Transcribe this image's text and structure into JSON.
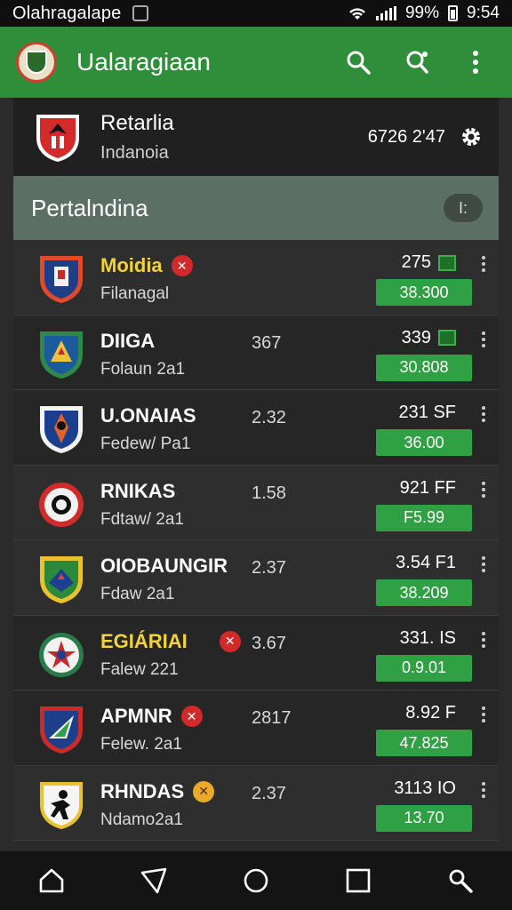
{
  "status_bar": {
    "title": "Olahragalape",
    "battery": "99%",
    "time": "9:54"
  },
  "app_bar": {
    "title": "Ualaragiaan"
  },
  "hero": {
    "team": "Retarlia",
    "subtitle": "Indanoia",
    "score": "6726 2'47"
  },
  "section": {
    "title": "Pertalndina",
    "button_label": "I:"
  },
  "matches": [
    {
      "team": "Moidia",
      "sub": "Filanagal",
      "odds": "",
      "score": "275",
      "pill": "38.300",
      "badge": "red",
      "highlight": true
    },
    {
      "team": "DIIGA",
      "sub": "Folaun 2a1",
      "odds": "367",
      "score": "339",
      "pill": "30.808",
      "badge": "",
      "highlight": false
    },
    {
      "team": "U.ONAIAS",
      "sub": "Fedew/ Pa1",
      "odds": "2.32",
      "score": "231 SF",
      "pill": "36.00",
      "badge": "",
      "highlight": false
    },
    {
      "team": "RNIKAS",
      "sub": "Fdtaw/ 2a1",
      "odds": "1.58",
      "score": "921 FF",
      "pill": "F5.99",
      "badge": "",
      "highlight": false
    },
    {
      "team": "OIOBAUNGIR",
      "sub": "Fdaw 2a1",
      "odds": "2.37",
      "score": "3.54 F1",
      "pill": "38.209",
      "badge": "",
      "highlight": false
    },
    {
      "team": "EGIÁRIAI",
      "sub": "Falew 221",
      "odds": "3.67",
      "score": "331. IS",
      "pill": "0.9.01",
      "badge": "red",
      "highlight": true
    },
    {
      "team": "APMNR",
      "sub": "Felew. 2a1",
      "odds": "2817",
      "score": "8.92 F",
      "pill": "47.825",
      "badge": "red",
      "highlight": false
    },
    {
      "team": "RHNDAS",
      "sub": "Ndamo2a1",
      "odds": "2.37",
      "score": "3113 IO",
      "pill": "13.70",
      "badge": "yellow",
      "highlight": false
    }
  ],
  "icons": {
    "app_actions": [
      "search-icon",
      "share-icon",
      "more-vert-icon"
    ],
    "nav": [
      "home-icon",
      "back-icon",
      "circle-home-icon",
      "recents-icon",
      "search-icon"
    ]
  },
  "colors": {
    "appbar": "#2f8e3a",
    "pill": "#2fa043",
    "section": "#5c6f64",
    "highlight_text": "#f3d23a",
    "badge_red": "#d22a2a"
  }
}
